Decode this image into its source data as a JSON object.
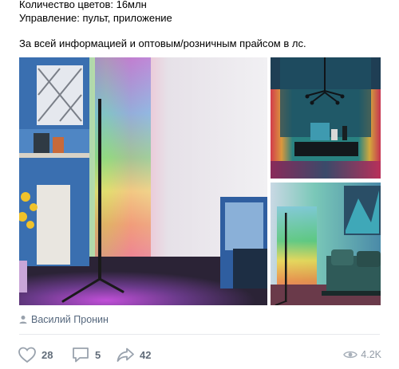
{
  "post": {
    "lines": [
      "Количество цветов: 16млн",
      "Управление: пульт, приложение",
      "За всей информацией и оптовым/розничным прайсом в лс."
    ],
    "author": "Василий Пронин"
  },
  "photos": [
    {
      "name": "corner-lamp-room-photo",
      "icon": "photo"
    },
    {
      "name": "living-room-tv-photo",
      "icon": "photo"
    },
    {
      "name": "bedroom-lamp-photo",
      "icon": "photo"
    }
  ],
  "footer": {
    "likes": "28",
    "comments": "5",
    "shares": "42",
    "views": "4.2K"
  },
  "icons": {
    "author": "person-icon",
    "like": "heart-icon",
    "comment": "comment-icon",
    "share": "share-arrow-icon",
    "views": "eye-icon"
  },
  "colors": {
    "accent": "#55677d",
    "action_text": "#626d7a",
    "muted": "#939ca7",
    "divider": "#e7e8ec"
  }
}
